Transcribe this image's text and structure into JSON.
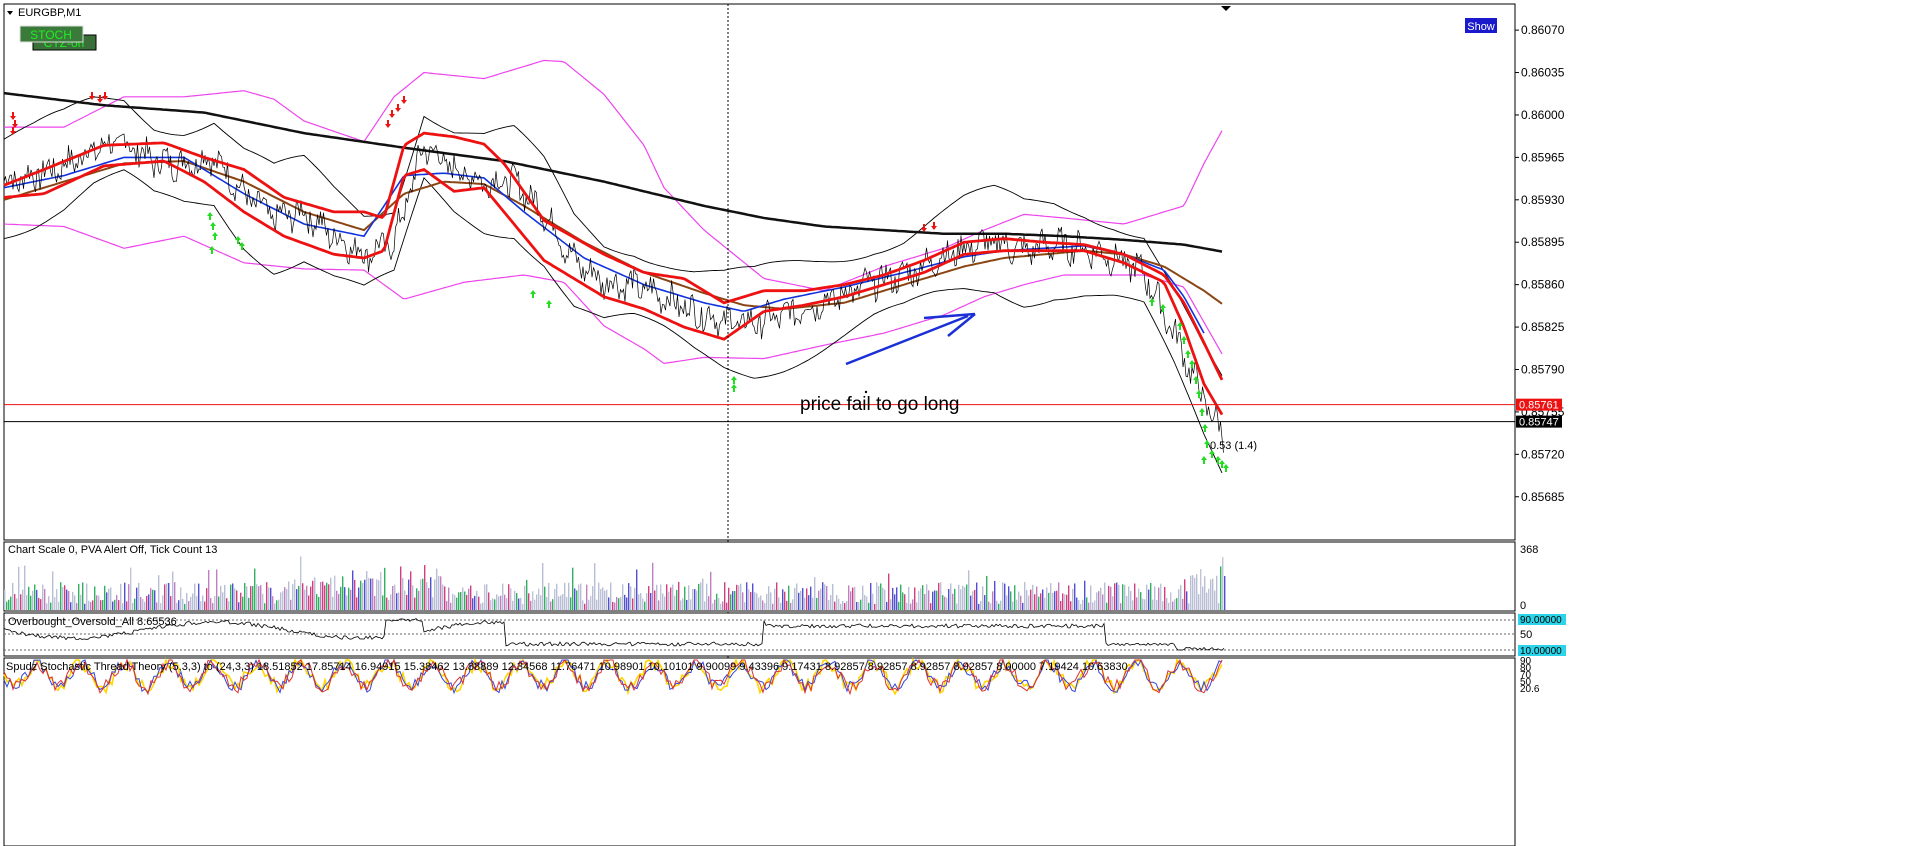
{
  "window": {
    "title": "EURGBP,M1"
  },
  "buttons": {
    "stoch": "STOCH",
    "ctz": "CTZ-on",
    "show": "Show"
  },
  "colors": {
    "bollinger_outer": "#ee44ee",
    "bollinger_inner": "#000000",
    "ma_red": "#ee1111",
    "ma_blue": "#1133dd",
    "ma_brown": "#8b4513",
    "ma_black": "#111111",
    "arrow_up": "#22dd22",
    "arrow_down": "#ee1111",
    "annotation_arrow": "#1a2fd6",
    "price_label_red": "#ee1111",
    "price_label_black": "#000000",
    "show_button": "#1a1acc",
    "stoch_button": "#3a7a3a",
    "stoch_text": "#22ee22"
  },
  "chart_data": {
    "type": "line",
    "symbol": "EURGBP",
    "timeframe": "M1",
    "y_axis": {
      "ylim": [
        0.85665,
        0.8608
      ],
      "ticks": [
        "0.86070",
        "0.86035",
        "0.86000",
        "0.85965",
        "0.85930",
        "0.85895",
        "0.85860",
        "0.85825",
        "0.85790",
        "0.85755",
        "0.85720",
        "0.85685"
      ]
    },
    "grid": false,
    "series": [
      {
        "key": "price",
        "x": [
          0,
          30,
          60,
          90,
          120,
          150,
          180,
          210,
          240,
          270,
          300,
          330,
          360,
          390,
          420,
          450,
          480,
          510,
          540,
          570,
          600,
          630,
          660,
          690,
          720,
          750,
          780,
          810,
          840,
          870,
          900,
          930,
          960,
          990,
          1020,
          1050,
          1080,
          1110,
          1140,
          1170,
          1200,
          1220
        ],
        "values": [
          0.85945,
          0.8595,
          0.85958,
          0.85972,
          0.85978,
          0.85962,
          0.8596,
          0.85965,
          0.85935,
          0.85915,
          0.8592,
          0.859,
          0.85885,
          0.85895,
          0.85975,
          0.85955,
          0.85945,
          0.85945,
          0.8592,
          0.8588,
          0.85862,
          0.8586,
          0.8585,
          0.85838,
          0.8583,
          0.85828,
          0.85835,
          0.85843,
          0.85852,
          0.85862,
          0.85868,
          0.8588,
          0.8589,
          0.85895,
          0.85888,
          0.85893,
          0.8589,
          0.85882,
          0.8587,
          0.8582,
          0.85765,
          0.85735
        ]
      },
      {
        "key": "bollinger_outer_top",
        "x": [
          0,
          60,
          120,
          180,
          240,
          270,
          300,
          360,
          390,
          420,
          480,
          540,
          560,
          600,
          640,
          660,
          700,
          760,
          820,
          880,
          940,
          980,
          1020,
          1060,
          1120,
          1180,
          1200,
          1220
        ],
        "values": [
          0.8599,
          0.8599,
          0.86015,
          0.86015,
          0.8602,
          0.86013,
          0.85995,
          0.85978,
          0.86015,
          0.86035,
          0.8603,
          0.86045,
          0.86044,
          0.86017,
          0.85975,
          0.8594,
          0.85905,
          0.85865,
          0.85855,
          0.85875,
          0.8589,
          0.85905,
          0.85918,
          0.85915,
          0.8591,
          0.85925,
          0.8596,
          0.8599
        ]
      },
      {
        "key": "bollinger_outer_bottom",
        "x": [
          0,
          60,
          120,
          180,
          240,
          300,
          360,
          400,
          460,
          520,
          560,
          600,
          640,
          660,
          700,
          760,
          820,
          880,
          940,
          980,
          1020,
          1060,
          1100,
          1140,
          1180,
          1220
        ],
        "values": [
          0.8591,
          0.85908,
          0.8589,
          0.859,
          0.85878,
          0.85873,
          0.85872,
          0.85848,
          0.85862,
          0.85868,
          0.85862,
          0.85826,
          0.85807,
          0.85795,
          0.858,
          0.85799,
          0.8581,
          0.8582,
          0.85835,
          0.8585,
          0.8586,
          0.85868,
          0.85868,
          0.85868,
          0.85858,
          0.858
        ]
      },
      {
        "key": "ma_red_top",
        "x": [
          0,
          40,
          100,
          160,
          200,
          240,
          280,
          330,
          360,
          380,
          400,
          420,
          450,
          480,
          500,
          540,
          600,
          640,
          680,
          720,
          760,
          800,
          840,
          880,
          920,
          960,
          1000,
          1040,
          1080,
          1120,
          1160,
          1180,
          1200,
          1220
        ],
        "values": [
          0.85942,
          0.85955,
          0.85975,
          0.85977,
          0.85965,
          0.85955,
          0.85932,
          0.8592,
          0.8592,
          0.85915,
          0.85975,
          0.85985,
          0.85982,
          0.85976,
          0.8596,
          0.85913,
          0.85885,
          0.8587,
          0.85865,
          0.85845,
          0.85855,
          0.85855,
          0.8586,
          0.85868,
          0.8588,
          0.85895,
          0.85898,
          0.85895,
          0.85893,
          0.85885,
          0.85868,
          0.85845,
          0.85812,
          0.85778
        ]
      },
      {
        "key": "ma_red_bottom",
        "x": [
          0,
          40,
          100,
          160,
          200,
          240,
          280,
          330,
          360,
          380,
          400,
          420,
          450,
          480,
          500,
          540,
          600,
          640,
          680,
          720,
          760,
          800,
          840,
          880,
          920,
          960,
          1000,
          1040,
          1080,
          1120,
          1160,
          1180,
          1200,
          1220
        ],
        "values": [
          0.85932,
          0.85935,
          0.85958,
          0.85962,
          0.85945,
          0.8592,
          0.859,
          0.85885,
          0.85882,
          0.85888,
          0.8595,
          0.85955,
          0.85937,
          0.8594,
          0.8592,
          0.8588,
          0.8585,
          0.8584,
          0.85825,
          0.85815,
          0.85838,
          0.85843,
          0.8585,
          0.8586,
          0.8587,
          0.85885,
          0.85888,
          0.85888,
          0.85888,
          0.85878,
          0.85862,
          0.85825,
          0.85778,
          0.8575
        ]
      },
      {
        "key": "ma_blue",
        "x": [
          0,
          60,
          120,
          180,
          240,
          300,
          360,
          400,
          440,
          480,
          520,
          580,
          640,
          700,
          740,
          780,
          840,
          900,
          960,
          1000,
          1040,
          1080,
          1120,
          1160,
          1180,
          1200
        ],
        "values": [
          0.8594,
          0.8595,
          0.85965,
          0.85965,
          0.85935,
          0.8591,
          0.859,
          0.8595,
          0.85952,
          0.85948,
          0.8592,
          0.85882,
          0.8586,
          0.85845,
          0.85838,
          0.85848,
          0.85858,
          0.8587,
          0.85883,
          0.85888,
          0.8589,
          0.85892,
          0.85885,
          0.85872,
          0.8585,
          0.8582
        ]
      },
      {
        "key": "ma_brown",
        "x": [
          0,
          60,
          120,
          180,
          240,
          300,
          360,
          400,
          440,
          480,
          520,
          580,
          640,
          700,
          740,
          780,
          840,
          900,
          960,
          1000,
          1040,
          1080,
          1120,
          1160,
          1200,
          1220
        ],
        "values": [
          0.8593,
          0.85945,
          0.8596,
          0.85962,
          0.85945,
          0.8592,
          0.85905,
          0.85935,
          0.85945,
          0.85943,
          0.85925,
          0.85895,
          0.8587,
          0.85853,
          0.85843,
          0.8584,
          0.85845,
          0.8586,
          0.85875,
          0.85882,
          0.85885,
          0.85888,
          0.85885,
          0.85875,
          0.85855,
          0.85843
        ]
      },
      {
        "key": "ma_black_long",
        "x": [
          0,
          100,
          200,
          300,
          400,
          500,
          600,
          700,
          760,
          820,
          880,
          940,
          1000,
          1060,
          1120,
          1180,
          1220
        ],
        "values": [
          0.86018,
          0.86008,
          0.86002,
          0.85985,
          0.85973,
          0.85962,
          0.85945,
          0.85925,
          0.85915,
          0.85908,
          0.85905,
          0.85902,
          0.85902,
          0.859,
          0.85897,
          0.85893,
          0.85887
        ]
      }
    ],
    "horizontal_lines": [
      {
        "value": 0.85761,
        "label": "0.85761",
        "color": "#ee1111"
      },
      {
        "value": 0.85747,
        "label": "0.85747",
        "color": "#000000"
      }
    ],
    "vertical_crosshair_x": 728,
    "annotations": [
      {
        "text": "price fail to go long"
      },
      {
        "text": "0.53 (1.4)"
      }
    ],
    "subwindows": [
      {
        "key": "volume",
        "label": "Chart Scale 0,   PVA Alert Off,   Tick Count  13",
        "ticks": [
          "368",
          "0"
        ]
      },
      {
        "key": "obos",
        "label": "Overbought_Oversold_All 8.65536",
        "ticks": [
          "90.00000",
          "50",
          "10.00000"
        ]
      },
      {
        "key": "spudz",
        "label": "Spudz Stochastic Thread Theory (5,3,3) to (24,3,3) 18.51852 17.85714 16.94915 15.38462 13.88889 12.34568 11.76471 10.98901 10.10101 9.90099 9.43396 9.17431 8.92857 8.92857 8.92857 8.92857 8.00000 7.19424 10.63830",
        "ticks": [
          "90",
          "80",
          "70",
          "50",
          "20.6"
        ]
      }
    ]
  }
}
